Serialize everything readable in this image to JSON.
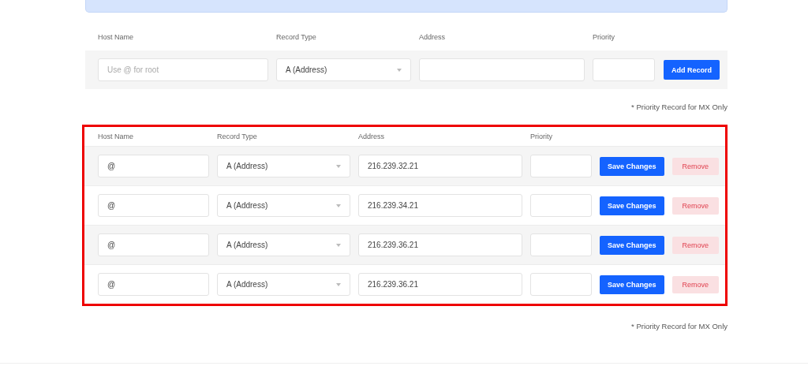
{
  "add_form": {
    "columns": [
      "Host Name",
      "Record Type",
      "Address",
      "Priority"
    ],
    "host": {
      "placeholder": "Use @ for root"
    },
    "record_type": {
      "value": "A (Address)"
    },
    "button": "Add Record"
  },
  "note_top": "* Priority Record for MX Only",
  "records": {
    "highlighted": true,
    "columns": [
      "Host Name",
      "Record Type",
      "Address",
      "Priority"
    ],
    "rows": [
      {
        "host": "@",
        "record_type": "A (Address)",
        "address": "216.239.32.21",
        "save": "Save Changes",
        "remove": "Remove"
      },
      {
        "host": "@",
        "record_type": "A (Address)",
        "address": "216.239.34.21",
        "save": "Save Changes",
        "remove": "Remove"
      },
      {
        "host": "@",
        "record_type": "A (Address)",
        "address": "216.239.36.21",
        "save": "Save Changes",
        "remove": "Remove"
      },
      {
        "host": "@",
        "record_type": "A (Address)",
        "address": "216.239.36.21",
        "save": "Save Changes",
        "remove": "Remove"
      }
    ]
  },
  "note_bottom": "* Priority Record for MX Only"
}
